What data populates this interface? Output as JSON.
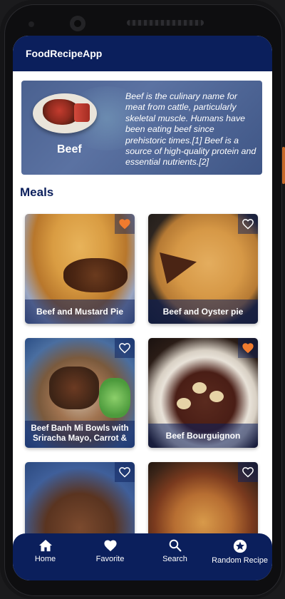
{
  "app": {
    "title": "FoodRecipeApp"
  },
  "category": {
    "name": "Beef",
    "description": "Beef is the culinary name for meat from cattle, particularly skeletal muscle. Humans have been eating beef since prehistoric times.[1] Beef is a source of high-quality protein and essential nutrients.[2]"
  },
  "section": {
    "title": "Meals"
  },
  "meals": [
    {
      "name": "Beef and Mustard Pie",
      "favorite": true,
      "icon": "heart-filled-icon"
    },
    {
      "name": "Beef and Oyster pie",
      "favorite": false,
      "icon": "heart-outline-icon"
    },
    {
      "name": "Beef Banh Mi Bowls with Sriracha Mayo, Carrot &",
      "favorite": false,
      "icon": "heart-outline-icon"
    },
    {
      "name": "Beef Bourguignon",
      "favorite": true,
      "icon": "heart-filled-icon"
    },
    {
      "name": "",
      "favorite": false,
      "icon": "heart-outline-icon"
    },
    {
      "name": "",
      "favorite": false,
      "icon": "heart-outline-icon"
    }
  ],
  "nav": {
    "items": [
      {
        "label": "Home",
        "icon": "home-icon"
      },
      {
        "label": "Favorite",
        "icon": "heart-icon"
      },
      {
        "label": "Search",
        "icon": "search-icon"
      },
      {
        "label": "Random Recipe",
        "icon": "star-circle-icon"
      }
    ]
  },
  "colors": {
    "primary": "#0b1f5c",
    "favorite": "#f07b2e",
    "white": "#ffffff"
  }
}
